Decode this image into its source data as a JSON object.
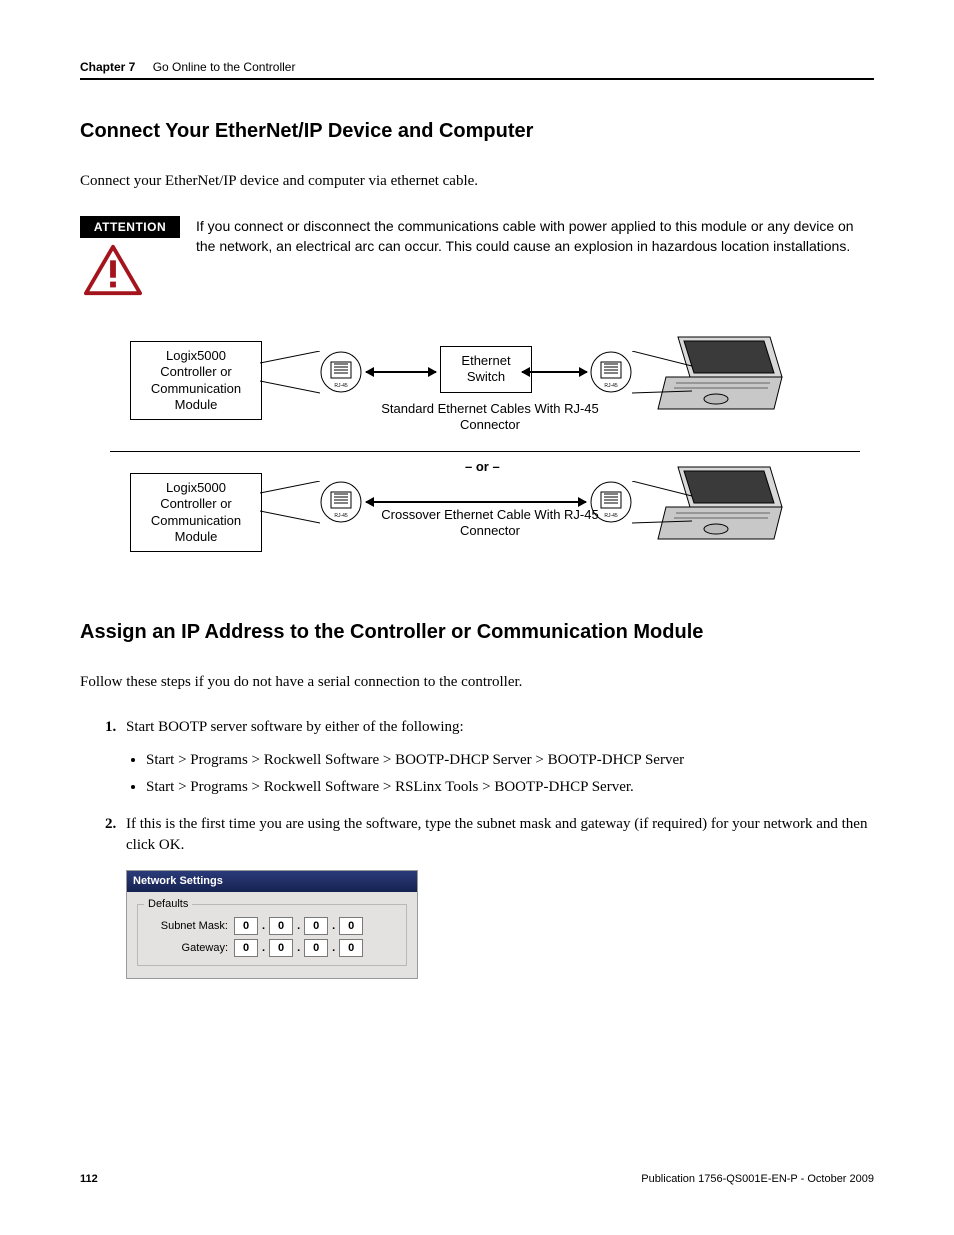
{
  "header": {
    "chapter": "Chapter 7",
    "title": "Go Online to the Controller"
  },
  "section1": {
    "heading": "Connect Your EtherNet/IP Device and Computer",
    "intro": "Connect your EtherNet/IP device and computer via ethernet cable.",
    "attention_label": "ATTENTION",
    "attention_text": "If you connect or disconnect the communications cable with power applied to this module or any device on the network, an electrical arc can occur. This could cause an explosion in hazardous location installations."
  },
  "diagram": {
    "module_label": "Logix5000 Controller or Communication Module",
    "switch_label": "Ethernet Switch",
    "std_cable_label": "Standard Ethernet Cables With RJ-45 Connector",
    "or_label": "– or –",
    "xover_cable_label": "Crossover Ethernet Cable With RJ-45 Connector",
    "jack_label": "RJ-45"
  },
  "section2": {
    "heading": "Assign an IP Address to the Controller or Communication Module",
    "intro": "Follow these steps if you do not have a serial connection to the controller.",
    "steps": [
      "Start BOOTP server software by either of the following:",
      "If this is the first time you are using the software, type the subnet mask and gateway (if required) for your network and then click OK."
    ],
    "paths": [
      "Start > Programs > Rockwell Software > BOOTP-DHCP Server > BOOTP-DHCP Server",
      "Start > Programs > Rockwell Software > RSLinx Tools > BOOTP-DHCP Server."
    ]
  },
  "netset": {
    "title": "Network Settings",
    "group": "Defaults",
    "subnet_label": "Subnet Mask:",
    "gateway_label": "Gateway:",
    "octets": [
      "0",
      "0",
      "0",
      "0"
    ]
  },
  "footer": {
    "page": "112",
    "pub": "Publication 1756-QS001E-EN-P - October 2009"
  }
}
